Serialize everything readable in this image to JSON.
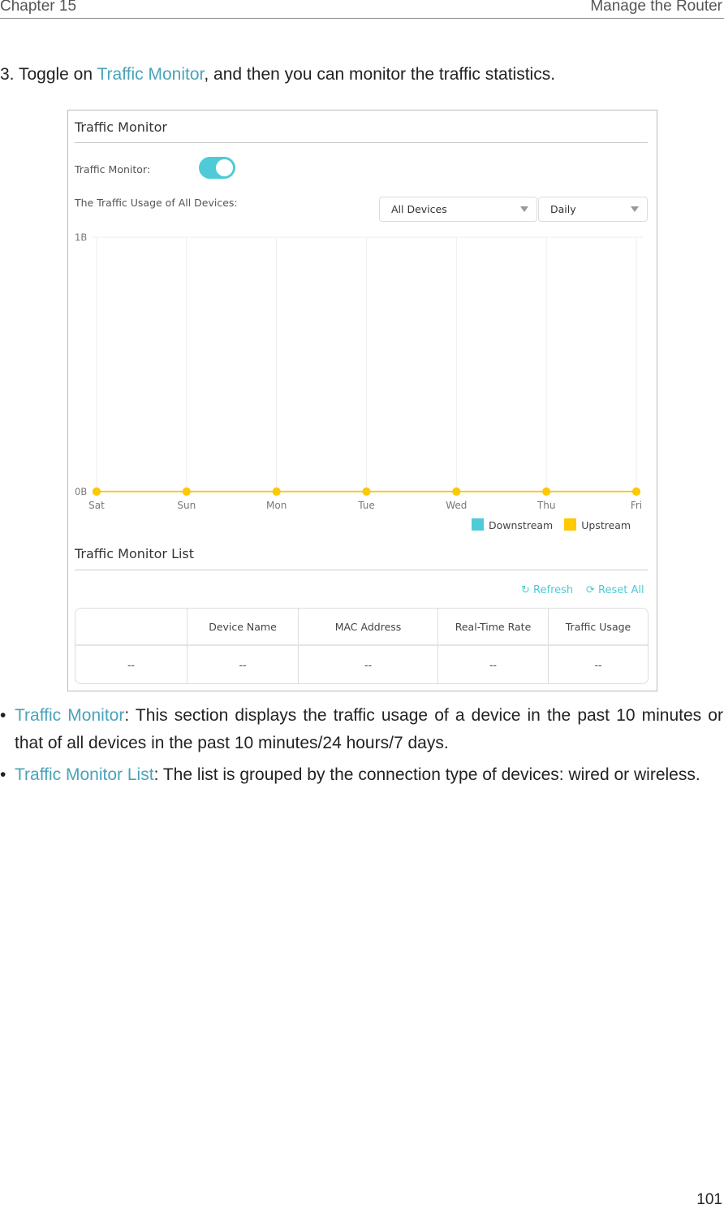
{
  "header": {
    "chapter": "Chapter 15",
    "section": "Manage the Router"
  },
  "step": {
    "prefix": "3. Toggle on ",
    "link": "Traffic Monitor",
    "suffix": ", and then you can monitor the traffic statistics."
  },
  "ui": {
    "title": "Traffic Monitor",
    "toggle_label": "Traffic Monitor:",
    "toggle_on": true,
    "usage_label": "The Traffic Usage of All Devices:",
    "device_select": "All Devices",
    "period_select": "Daily",
    "list_title": "Traffic Monitor List",
    "refresh": "Refresh",
    "reset_all": "Reset All",
    "accent": "#4ecbd6",
    "table": {
      "headers": [
        "",
        "Device Name",
        "MAC Address",
        "Real-Time Rate",
        "Traffic Usage"
      ],
      "rows": [
        [
          "--",
          "--",
          "--",
          "--",
          "--"
        ]
      ]
    }
  },
  "chart_data": {
    "type": "line",
    "categories": [
      "Sat",
      "Sun",
      "Mon",
      "Tue",
      "Wed",
      "Thu",
      "Fri"
    ],
    "y_ticks": [
      "1B",
      "0B"
    ],
    "ylim": [
      0,
      1
    ],
    "grid": true,
    "legend_placement": "bottom-right",
    "series": [
      {
        "name": "Downstream",
        "color": "#4ecbd6",
        "values": [
          0,
          0,
          0,
          0,
          0,
          0,
          0
        ]
      },
      {
        "name": "Upstream",
        "color": "#ffc800",
        "values": [
          0,
          0,
          0,
          0,
          0,
          0,
          0
        ]
      }
    ]
  },
  "bullets": [
    {
      "term": "Traffic Monitor",
      "text": ": This section displays the traffic usage of a device in the past 10 minutes or that of all devices in the past 10 minutes/24 hours/7 days."
    },
    {
      "term": "Traffic Monitor List",
      "text": ": The list is grouped by the connection type of devices: wired or wireless."
    }
  ],
  "page_number": "101"
}
